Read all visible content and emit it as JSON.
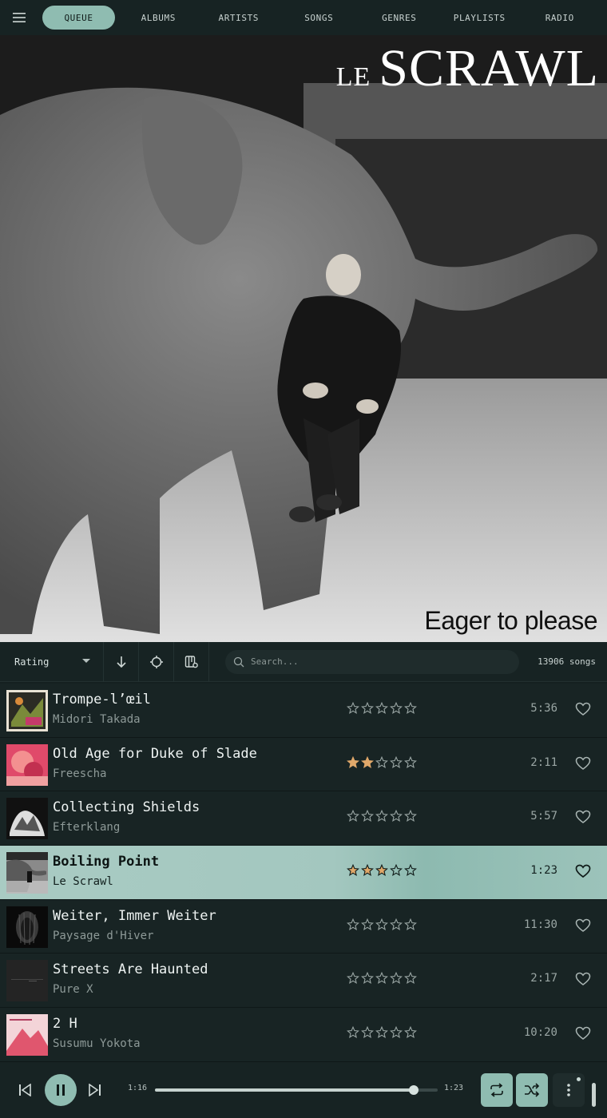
{
  "nav": {
    "menu_icon": "hamburger-icon",
    "tabs": [
      {
        "label": "QUEUE",
        "active": true
      },
      {
        "label": "ALBUMS",
        "active": false
      },
      {
        "label": "ARTISTS",
        "active": false
      },
      {
        "label": "SONGS",
        "active": false
      },
      {
        "label": "GENRES",
        "active": false
      },
      {
        "label": "PLAYLISTS",
        "active": false
      },
      {
        "label": "RADIO",
        "active": false
      }
    ]
  },
  "album_art": {
    "artist_prefix": "LE",
    "artist_name": "SCRAWL",
    "album_title": "Eager to please"
  },
  "toolbar": {
    "sort_label": "Rating",
    "search_placeholder": "Search...",
    "song_count": "13906 songs"
  },
  "songs": [
    {
      "title": "Trompe-l’œil",
      "artist": "Midori Takada",
      "rating": 0,
      "duration": "5:36",
      "playing": false
    },
    {
      "title": "Old Age for Duke of Slade",
      "artist": "Freescha",
      "rating": 2,
      "duration": "2:11",
      "playing": false
    },
    {
      "title": "Collecting Shields",
      "artist": "Efterklang",
      "rating": 0,
      "duration": "5:57",
      "playing": false
    },
    {
      "title": "Boiling Point",
      "artist": "Le Scrawl",
      "rating": 3,
      "duration": "1:23",
      "playing": true
    },
    {
      "title": "Weiter, Immer Weiter",
      "artist": "Paysage d'Hiver",
      "rating": 0,
      "duration": "11:30",
      "playing": false
    },
    {
      "title": "Streets Are Haunted",
      "artist": "Pure X",
      "rating": 0,
      "duration": "2:17",
      "playing": false
    },
    {
      "title": "2 H",
      "artist": "Susumu Yokota",
      "rating": 0,
      "duration": "10:20",
      "playing": false
    }
  ],
  "player": {
    "current_time": "1:16",
    "total_time": "1:23",
    "progress": 0.9157,
    "colors": {
      "accent": "#8fbcb1",
      "background": "#172323",
      "star_filled": "#e0a86a"
    }
  }
}
